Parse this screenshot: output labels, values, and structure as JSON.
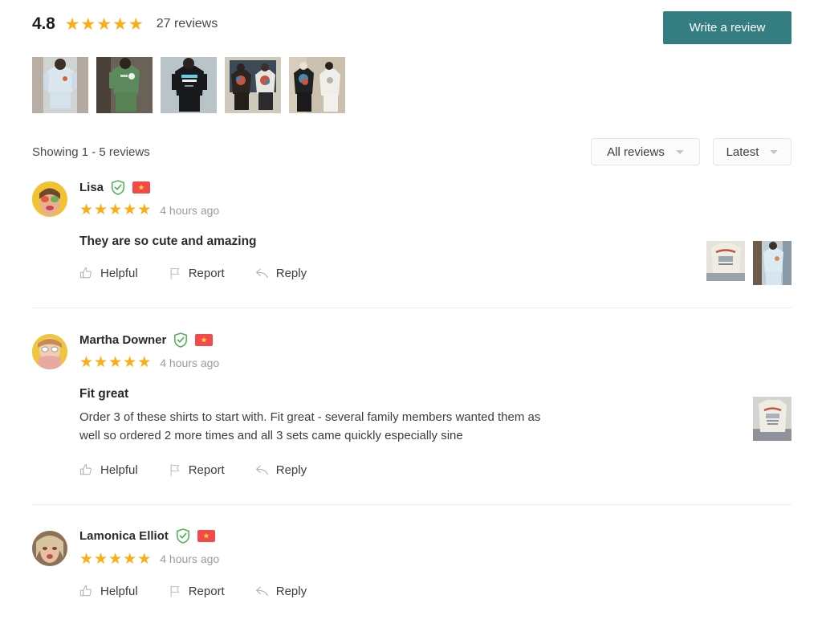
{
  "summary": {
    "rating_score": "4.8",
    "star_count": 5,
    "review_count_label": "27 reviews",
    "write_review_label": "Write a review",
    "accent_color": "#347e81",
    "star_color": "#FAAD14"
  },
  "thumbnails": [
    {
      "name": "thumbnail-light-blue-tee",
      "alt": "Person wearing light blue oversized tee"
    },
    {
      "name": "thumbnail-green-tee",
      "alt": "Person wearing green floral tee"
    },
    {
      "name": "thumbnail-black-tee",
      "alt": "Person wearing black graphic tee"
    },
    {
      "name": "thumbnail-back-print-pair",
      "alt": "Two people in back-print tees"
    },
    {
      "name": "thumbnail-black-white-pair",
      "alt": "Two people in black and white tees"
    }
  ],
  "filter_bar": {
    "showing_text": "Showing 1 - 5 reviews",
    "review_type_filter": {
      "value": "All reviews",
      "icon": "chevron-down-icon"
    },
    "sort_filter": {
      "value": "Latest",
      "icon": "chevron-down-icon"
    }
  },
  "actions": {
    "helpful": "Helpful",
    "report": "Report",
    "reply": "Reply"
  },
  "reviews": [
    {
      "name": "Lisa",
      "verified": true,
      "country_flag": "vietnam-flag-icon",
      "stars": 5,
      "time_ago": "4 hours ago",
      "title": "They are so cute and amazing",
      "text": "",
      "photos": [
        {
          "name": "review-photo-cream-tee-back"
        },
        {
          "name": "review-photo-blue-tee-front"
        }
      ]
    },
    {
      "name": "Martha Downer",
      "verified": true,
      "country_flag": "vietnam-flag-icon",
      "stars": 5,
      "time_ago": "4 hours ago",
      "title": "Fit great",
      "text": "Order 3 of these shirts to start with. Fit great - several family members wanted them as well so ordered 2 more times and all 3 sets came quickly especially sine",
      "photos": [
        {
          "name": "review-photo-cream-graphic-tee"
        }
      ]
    },
    {
      "name": "Lamonica Elliot",
      "verified": true,
      "country_flag": "vietnam-flag-icon",
      "stars": 5,
      "time_ago": "4 hours ago",
      "title": "",
      "text": "",
      "photos": []
    }
  ]
}
